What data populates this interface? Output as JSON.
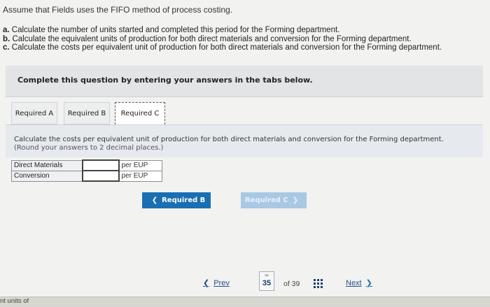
{
  "intro": "Assume that Fields uses the FIFO method of process costing.",
  "tasks": [
    {
      "letter": "a.",
      "text": "Calculate the number of units started and completed this period for the Forming department."
    },
    {
      "letter": "b.",
      "text": "Calculate the equivalent units of production for both direct materials and conversion for the Forming department."
    },
    {
      "letter": "c.",
      "text": "Calculate the costs per equivalent unit of production for both direct materials and conversion for the Forming department."
    }
  ],
  "panel_title": "Complete this question by entering your answers in the tabs below.",
  "tabs": [
    {
      "label": "Required A"
    },
    {
      "label": "Required B"
    },
    {
      "label": "Required C"
    }
  ],
  "content": {
    "line1": "Calculate the costs per equivalent unit of production for both direct materials and conversion for the Forming department.",
    "line2": "(Round your answers to 2 decimal places.)"
  },
  "answers": [
    {
      "label": "Direct Materials",
      "value": "",
      "unit": "per EUP"
    },
    {
      "label": "Conversion",
      "value": "",
      "unit": "per EUP"
    }
  ],
  "nav_buttons": {
    "prev_label": "Required B",
    "next_label": "Required C"
  },
  "footer": {
    "prev": "Prev",
    "page": "35",
    "of": "of 39",
    "next": "Next"
  },
  "bottom_text": "nt units of",
  "colors": {
    "primary": "#1a6fb3",
    "disabled": "#a9c8e4",
    "panel": "#e2e4e6"
  }
}
